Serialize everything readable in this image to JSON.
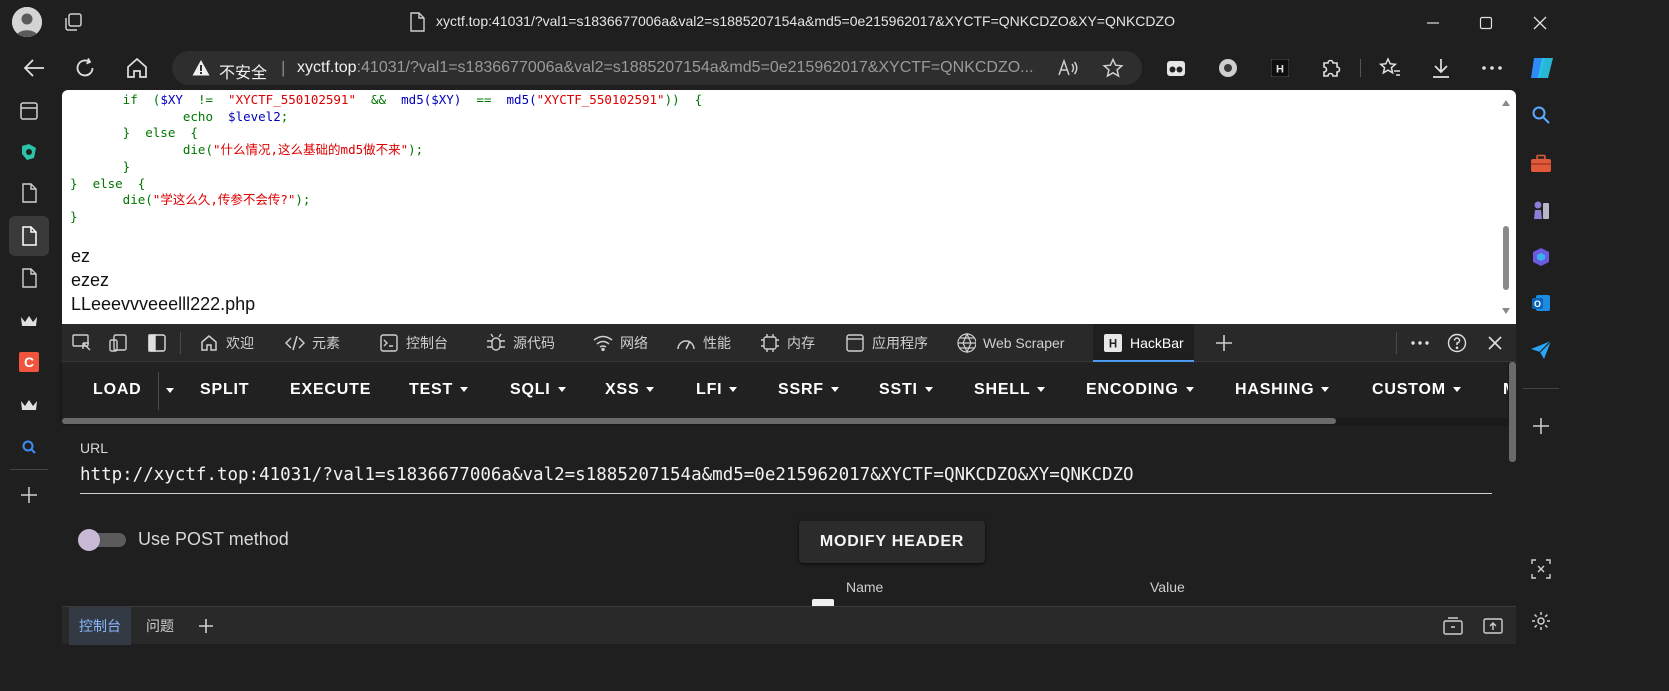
{
  "window": {
    "title": "xyctf.top:41031/?val1=s1836677006a&val2=s1885207154a&md5=0e215962017&XYCTF=QNKCDZO&XY=QNKCDZO"
  },
  "addressbar": {
    "security_label": "不安全",
    "separator": "|",
    "host": "xyctf.top",
    "url_rest": ":41031/?val1=s1836677006a&val2=s1885207154a&md5=0e215962017&XYCTF=QNKCDZO..."
  },
  "page": {
    "code": {
      "l1_pre": "       if  (",
      "l1_v1": "$XY",
      "l1_op1": "  !=  ",
      "l1_s1": "\"XYCTF_550102591\"",
      "l1_op2": "  &&  ",
      "l1_f1": "md5(",
      "l1_v2": "$XY",
      "l1_f1c": ")",
      "l1_op3": "  ==  ",
      "l1_f2": "md5(",
      "l1_s2": "\"XYCTF_550102591\"",
      "l1_end": "))  {",
      "l2_pre": "               echo  ",
      "l2_var": "$level2",
      "l2_end": ";",
      "l3": "       }  else  {",
      "l4_pre": "               die(",
      "l4_str": "\"什么情况,这么基础的md5做不来\"",
      "l4_end": ");",
      "l5": "       }",
      "l6": "}  else  {",
      "l7_pre": "       die(",
      "l7_str": "\"学这么久,传参不会传?\"",
      "l7_end": ");",
      "l8": "}"
    },
    "output": [
      "ez",
      "ezez",
      "LLeeevvveeelll222.php"
    ]
  },
  "devtools": {
    "tabs": [
      "欢迎",
      "元素",
      "控制台",
      "源代码",
      "网络",
      "性能",
      "内存",
      "应用程序",
      "Web Scraper",
      "HackBar"
    ],
    "active_tab": "HackBar",
    "drawer_tabs": [
      "控制台",
      "问题"
    ]
  },
  "hackbar": {
    "buttons": [
      {
        "label": "LOAD",
        "dropdown": false
      },
      {
        "label": "SPLIT",
        "dropdown": false
      },
      {
        "label": "EXECUTE",
        "dropdown": false
      },
      {
        "label": "TEST",
        "dropdown": true
      },
      {
        "label": "SQLI",
        "dropdown": true
      },
      {
        "label": "XSS",
        "dropdown": true
      },
      {
        "label": "LFI",
        "dropdown": true
      },
      {
        "label": "SSRF",
        "dropdown": true
      },
      {
        "label": "SSTI",
        "dropdown": true
      },
      {
        "label": "SHELL",
        "dropdown": true
      },
      {
        "label": "ENCODING",
        "dropdown": true
      },
      {
        "label": "HASHING",
        "dropdown": true
      },
      {
        "label": "CUSTOM",
        "dropdown": true
      },
      {
        "label": "M",
        "dropdown": false
      }
    ],
    "url_label": "URL",
    "url_value": "http://xyctf.top:41031/?val1=s1836677006a&val2=s1885207154a&md5=0e215962017&XYCTF=QNKCDZO&XY=QNKCDZO",
    "post_label": "Use POST method",
    "post_enabled": false,
    "modify_header": "MODIFY HEADER",
    "header_columns": [
      "Name",
      "Value"
    ]
  },
  "colors": {
    "php_keyword": "#007700",
    "php_variable": "#0000bb",
    "php_string": "#dd0000",
    "accent": "#4fa3ff"
  }
}
